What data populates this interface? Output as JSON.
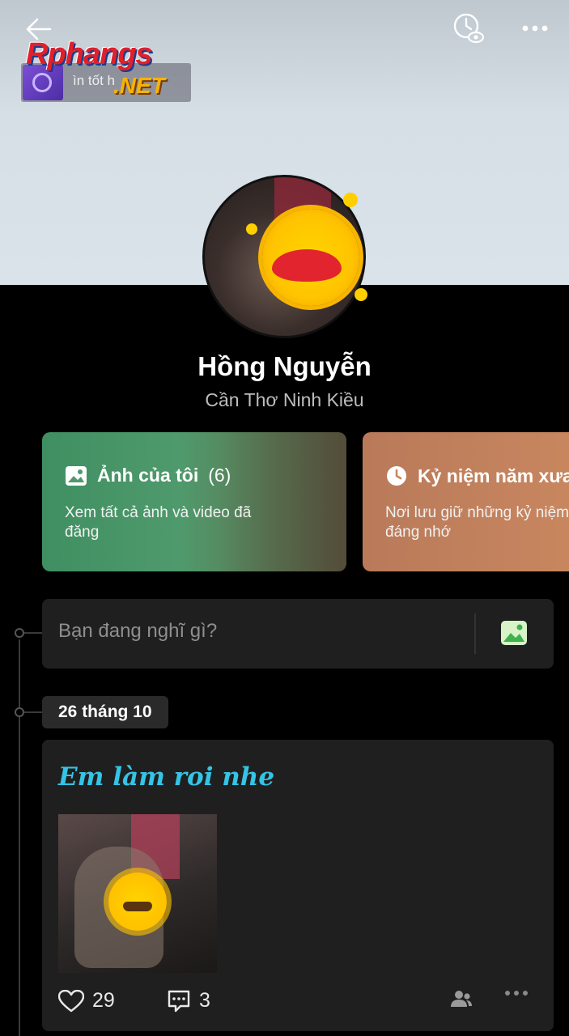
{
  "watermark": {
    "brand": "Rphangs",
    "domain": ".NET",
    "tagline": "ìn tốt h"
  },
  "topbar": {
    "back_icon": "arrow-left-icon",
    "history_icon": "clock-eye-icon",
    "more_icon": "more-horizontal-icon"
  },
  "profile": {
    "name": "Hồng Nguyễn",
    "location": "Cần Thơ Ninh Kiều"
  },
  "cards": [
    {
      "title": "Ảnh của tôi",
      "count": "(6)",
      "subtitle": "Xem tất cả ảnh và video đã đăng",
      "icon": "photo-icon"
    },
    {
      "title": "Kỷ niệm năm xưa",
      "subtitle": "Nơi lưu giữ những kỷ niệm đáng nhớ",
      "icon": "history-icon"
    }
  ],
  "composer": {
    "placeholder": "Bạn đang nghĩ gì?",
    "photo_icon": "gallery-icon"
  },
  "timeline": {
    "date_label": "26 tháng 10"
  },
  "post": {
    "text": "Em làm roi nhe",
    "likes": "29",
    "comments": "3",
    "privacy_icon": "friends-icon",
    "more_icon": "more-horizontal-icon"
  },
  "colors": {
    "background": "#000000",
    "post_text": "#33c4e6",
    "card_photos": "#4f9a6c",
    "card_memories": "#c9875f"
  }
}
